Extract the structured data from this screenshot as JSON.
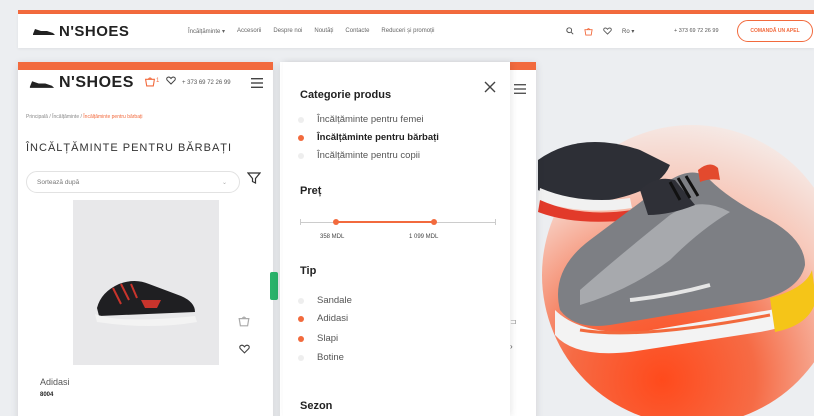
{
  "desktop_header": {
    "brand": "N'SHOES",
    "nav": [
      "Încălțăminte ▾",
      "Accesorii",
      "Despre noi",
      "Noutăți",
      "Contacte",
      "Reduceri și promoții"
    ],
    "lang": "Ro ▾",
    "phone": "+ 373 69 72 26 99",
    "call_button": "COMANDĂ UN APEL"
  },
  "mobile": {
    "brand": "N'SHOES",
    "cart_count": "1",
    "phone": "+ 373 69 72 26 99",
    "breadcrumb": {
      "home": "Principală",
      "sep": " / ",
      "parent": "Încălțăminte",
      "current": "Încălțăminte pentru bărbați"
    },
    "title": "ÎNCĂLȚĂMINTE PENTRU BĂRBAȚI",
    "sort_placeholder": "Sortează după",
    "product": {
      "name": "Adidasi",
      "code": "8004"
    }
  },
  "filter_panel": {
    "category_heading": "Categorie produs",
    "categories": [
      {
        "label": "Încălțăminte pentru femei",
        "selected": false
      },
      {
        "label": "Încălțăminte pentru bărbați",
        "selected": true
      },
      {
        "label": "Încălțăminte pentru copii",
        "selected": false
      }
    ],
    "price_heading": "Preț",
    "price_min_label": "358 MDL",
    "price_max_label": "1 099 MDL",
    "type_heading": "Tip",
    "types": [
      {
        "label": "Sandale",
        "selected": false
      },
      {
        "label": "Adidasi",
        "selected": true
      },
      {
        "label": "Slapi",
        "selected": true
      },
      {
        "label": "Botine",
        "selected": false
      }
    ],
    "season_heading": "Sezon"
  },
  "colors": {
    "accent": "#f26a3d",
    "text_dark": "#222222",
    "background": "#eceef1"
  },
  "icons": [
    "search-icon",
    "cart-icon",
    "heart-icon",
    "menu-icon",
    "filter-icon",
    "close-icon",
    "chevron-down-icon"
  ]
}
